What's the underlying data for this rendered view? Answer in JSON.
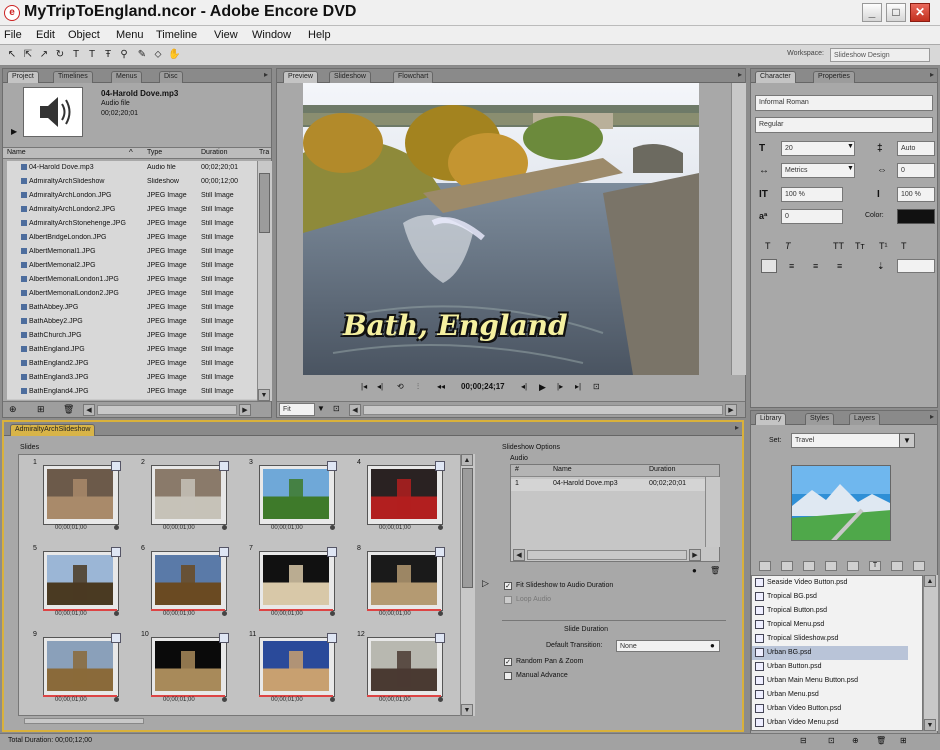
{
  "window": {
    "title": "MyTripToEngland.ncor - Adobe Encore DVD",
    "min": "_",
    "max": "□",
    "close": "✕"
  },
  "menu": [
    "File",
    "Edit",
    "Object",
    "Menu",
    "Timeline",
    "View",
    "Window",
    "Help"
  ],
  "toolbar": {
    "workspace_label": "Workspace:",
    "workspace_value": "Slideshow Design"
  },
  "project": {
    "tabs": [
      "Project",
      "Timelines",
      "Menus",
      "Disc"
    ],
    "preview_name": "04-Harold Dove.mp3",
    "preview_type": "Audio file",
    "preview_duration": "00;02;20;01",
    "columns": [
      "Name",
      "Type",
      "Duration",
      "Tra"
    ],
    "rows": [
      {
        "name": "04-Harold Dove.mp3",
        "type": "Audio file",
        "dur": "00;02;20;01"
      },
      {
        "name": "AdmiraltyArchSlideshow",
        "type": "Slideshow",
        "dur": "00;00;12;00"
      },
      {
        "name": "AdmiraltyArchLondon.JPG",
        "type": "JPEG Image",
        "dur": "Still Image"
      },
      {
        "name": "AdmiraltyArchLondon2.JPG",
        "type": "JPEG Image",
        "dur": "Still Image"
      },
      {
        "name": "AdmiraltyArchStonehenge.JPG",
        "type": "JPEG Image",
        "dur": "Still Image"
      },
      {
        "name": "AlbertBridgeLondon.JPG",
        "type": "JPEG Image",
        "dur": "Still Image"
      },
      {
        "name": "AlbertMemorial1.JPG",
        "type": "JPEG Image",
        "dur": "Still Image"
      },
      {
        "name": "AlbertMemorial2.JPG",
        "type": "JPEG Image",
        "dur": "Still Image"
      },
      {
        "name": "AlbertMemorialLondon1.JPG",
        "type": "JPEG Image",
        "dur": "Still Image"
      },
      {
        "name": "AlbertMemorialLondon2.JPG",
        "type": "JPEG Image",
        "dur": "Still Image"
      },
      {
        "name": "BathAbbey.JPG",
        "type": "JPEG Image",
        "dur": "Still Image"
      },
      {
        "name": "BathAbbey2.JPG",
        "type": "JPEG Image",
        "dur": "Still Image"
      },
      {
        "name": "BathChurch.JPG",
        "type": "JPEG Image",
        "dur": "Still Image"
      },
      {
        "name": "BathEngland.JPG",
        "type": "JPEG Image",
        "dur": "Still Image"
      },
      {
        "name": "BathEngland2.JPG",
        "type": "JPEG Image",
        "dur": "Still Image"
      },
      {
        "name": "BathEngland3.JPG",
        "type": "JPEG Image",
        "dur": "Still Image"
      },
      {
        "name": "BathEngland4.JPG",
        "type": "JPEG Image",
        "dur": "Still Image"
      }
    ]
  },
  "monitor": {
    "tabs": [
      "Preview",
      "Slideshow",
      "Flowchart"
    ],
    "caption": "Bath, England",
    "timecode": "00;00;24;17",
    "zoom": "Fit"
  },
  "character": {
    "tabs": [
      "Character",
      "Properties"
    ],
    "font": "Informal Roman",
    "style": "Regular",
    "size": "20",
    "leading": "Auto",
    "kerning": "Metrics",
    "tracking": "0",
    "vscale": "100 %",
    "hscale": "100 %",
    "baseline": "0",
    "color_label": "Color:"
  },
  "slideshow": {
    "tab": "AdmiraltyArchSlideshow",
    "slides_label": "Slides",
    "options_title": "Slideshow Options",
    "audio_label": "Audio",
    "audio_cols": [
      "#",
      "Name",
      "Duration"
    ],
    "audio_row": {
      "num": "1",
      "name": "04-Harold Dove.mp3",
      "dur": "00;02;20;01"
    },
    "fit_label": "Fit Slideshow to Audio Duration",
    "loop_label": "Loop Audio",
    "slide_duration_label": "Slide Duration",
    "default_transition_label": "Default Transition:",
    "default_transition_value": "None",
    "pan_zoom_label": "Random Pan & Zoom",
    "advance_label": "Manual Advance",
    "slides": [
      {
        "n": "1",
        "dur": "00;00;01;00"
      },
      {
        "n": "2",
        "dur": "00;00;01;00"
      },
      {
        "n": "3",
        "dur": "00;00;01;00"
      },
      {
        "n": "4",
        "dur": "00;00;01;00"
      },
      {
        "n": "5",
        "dur": "00;00;01;00"
      },
      {
        "n": "6",
        "dur": "00;00;01;00"
      },
      {
        "n": "7",
        "dur": "00;00;01;00"
      },
      {
        "n": "8",
        "dur": "00;00;01;00"
      },
      {
        "n": "9",
        "dur": "00;00;01;00"
      },
      {
        "n": "10",
        "dur": "00;00;01;00"
      },
      {
        "n": "11",
        "dur": "00;00;01;00"
      },
      {
        "n": "12",
        "dur": "00;00;01;00"
      }
    ]
  },
  "library": {
    "tabs": [
      "Library",
      "Styles",
      "Layers"
    ],
    "set_label": "Set:",
    "set_value": "Travel",
    "items": [
      {
        "name": "Seaside Video Button.psd",
        "sel": false
      },
      {
        "name": "Tropical BG.psd",
        "sel": false
      },
      {
        "name": "Tropical Button.psd",
        "sel": false
      },
      {
        "name": "Tropical Menu.psd",
        "sel": false
      },
      {
        "name": "Tropical Slideshow.psd",
        "sel": false
      },
      {
        "name": "Urban BG.psd",
        "sel": true
      },
      {
        "name": "Urban Button.psd",
        "sel": false
      },
      {
        "name": "Urban Main Menu Button.psd",
        "sel": false
      },
      {
        "name": "Urban Menu.psd",
        "sel": false
      },
      {
        "name": "Urban Video Button.psd",
        "sel": false
      },
      {
        "name": "Urban Video Menu.psd",
        "sel": false
      }
    ]
  },
  "status": {
    "text": "Total Duration: 00;00;12;00"
  }
}
